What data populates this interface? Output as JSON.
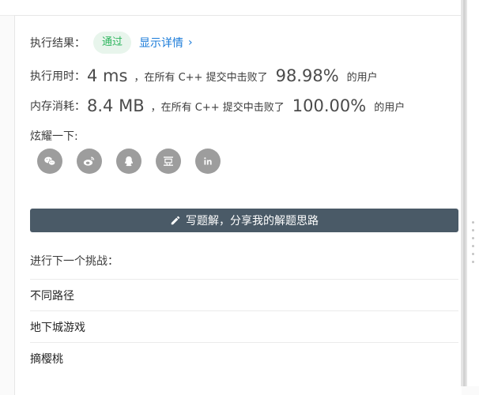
{
  "result": {
    "label": "执行结果：",
    "status": "通过",
    "detail_link": "显示详情"
  },
  "time": {
    "label": "执行用时：",
    "value": "4 ms",
    "compare_text": "，在所有 C++ 提交中击败了",
    "percent": "98.98%",
    "tail": "的用户"
  },
  "memory": {
    "label": "内存消耗：",
    "value": "8.4 MB",
    "compare_text": "，在所有 C++ 提交中击败了",
    "percent": "100.00%",
    "tail": "的用户"
  },
  "share": {
    "label": "炫耀一下:",
    "icons": [
      "wechat-icon",
      "weibo-icon",
      "qq-icon",
      "douban-icon",
      "linkedin-icon"
    ]
  },
  "write_solution": {
    "label": "写题解，分享我的解题思路"
  },
  "next_challenge": {
    "label": "进行下一个挑战：",
    "items": [
      "不同路径",
      "地下城游戏",
      "摘樱桃"
    ]
  },
  "colors": {
    "success_bg": "#e8f5ec",
    "success_text": "#2db55d",
    "link": "#1a7bd9",
    "button_bg": "#4a5a67",
    "icon_bg": "#9d9d9d"
  }
}
